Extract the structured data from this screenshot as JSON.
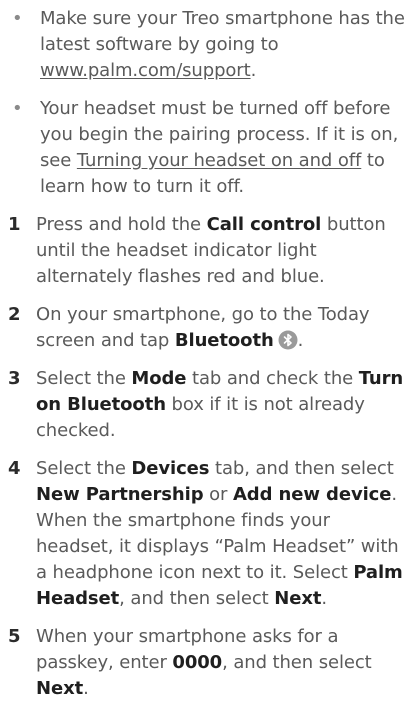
{
  "items": [
    {
      "marker": "•",
      "parts": [
        {
          "t": "Make sure your Treo smartphone has the latest software by going to "
        },
        {
          "t": "www.palm.com/support",
          "u": true
        },
        {
          "t": "."
        }
      ]
    },
    {
      "marker": "•",
      "parts": [
        {
          "t": "Your headset must be turned off before you begin the pairing process. If it is on, see "
        },
        {
          "t": "Turning your headset on and off",
          "u": true
        },
        {
          "t": " to learn how to turn it off."
        }
      ]
    },
    {
      "marker": "1",
      "parts": [
        {
          "t": "Press and hold the "
        },
        {
          "t": "Call control",
          "b": true
        },
        {
          "t": " button until the headset indicator light alternately flashes red and blue."
        }
      ]
    },
    {
      "marker": "2",
      "parts": [
        {
          "t": "On your smartphone, go to the Today screen and tap "
        },
        {
          "t": "Bluetooth",
          "b": true
        },
        {
          "icon": "bluetooth-icon"
        },
        {
          "t": "."
        }
      ]
    },
    {
      "marker": "3",
      "parts": [
        {
          "t": "Select the "
        },
        {
          "t": "Mode",
          "b": true
        },
        {
          "t": " tab and check the "
        },
        {
          "t": "Turn on Bluetooth",
          "b": true
        },
        {
          "t": " box if it is not already checked."
        }
      ]
    },
    {
      "marker": "4",
      "parts": [
        {
          "t": "Select the "
        },
        {
          "t": "Devices",
          "b": true
        },
        {
          "t": " tab, and then select "
        },
        {
          "t": "New Partnership",
          "b": true
        },
        {
          "t": " or "
        },
        {
          "t": "Add new device",
          "b": true
        },
        {
          "t": ". When the smartphone finds your headset, it displays “Palm Headset” with a headphone icon next to it. Select "
        },
        {
          "t": "Palm Headset",
          "b": true
        },
        {
          "t": ", and then select "
        },
        {
          "t": "Next",
          "b": true
        },
        {
          "t": "."
        }
      ]
    },
    {
      "marker": "5",
      "parts": [
        {
          "t": "When your smartphone asks for a passkey, enter "
        },
        {
          "t": "0000",
          "b": true
        },
        {
          "t": ", and then select "
        },
        {
          "t": "Next",
          "b": true
        },
        {
          "t": "."
        }
      ]
    }
  ]
}
